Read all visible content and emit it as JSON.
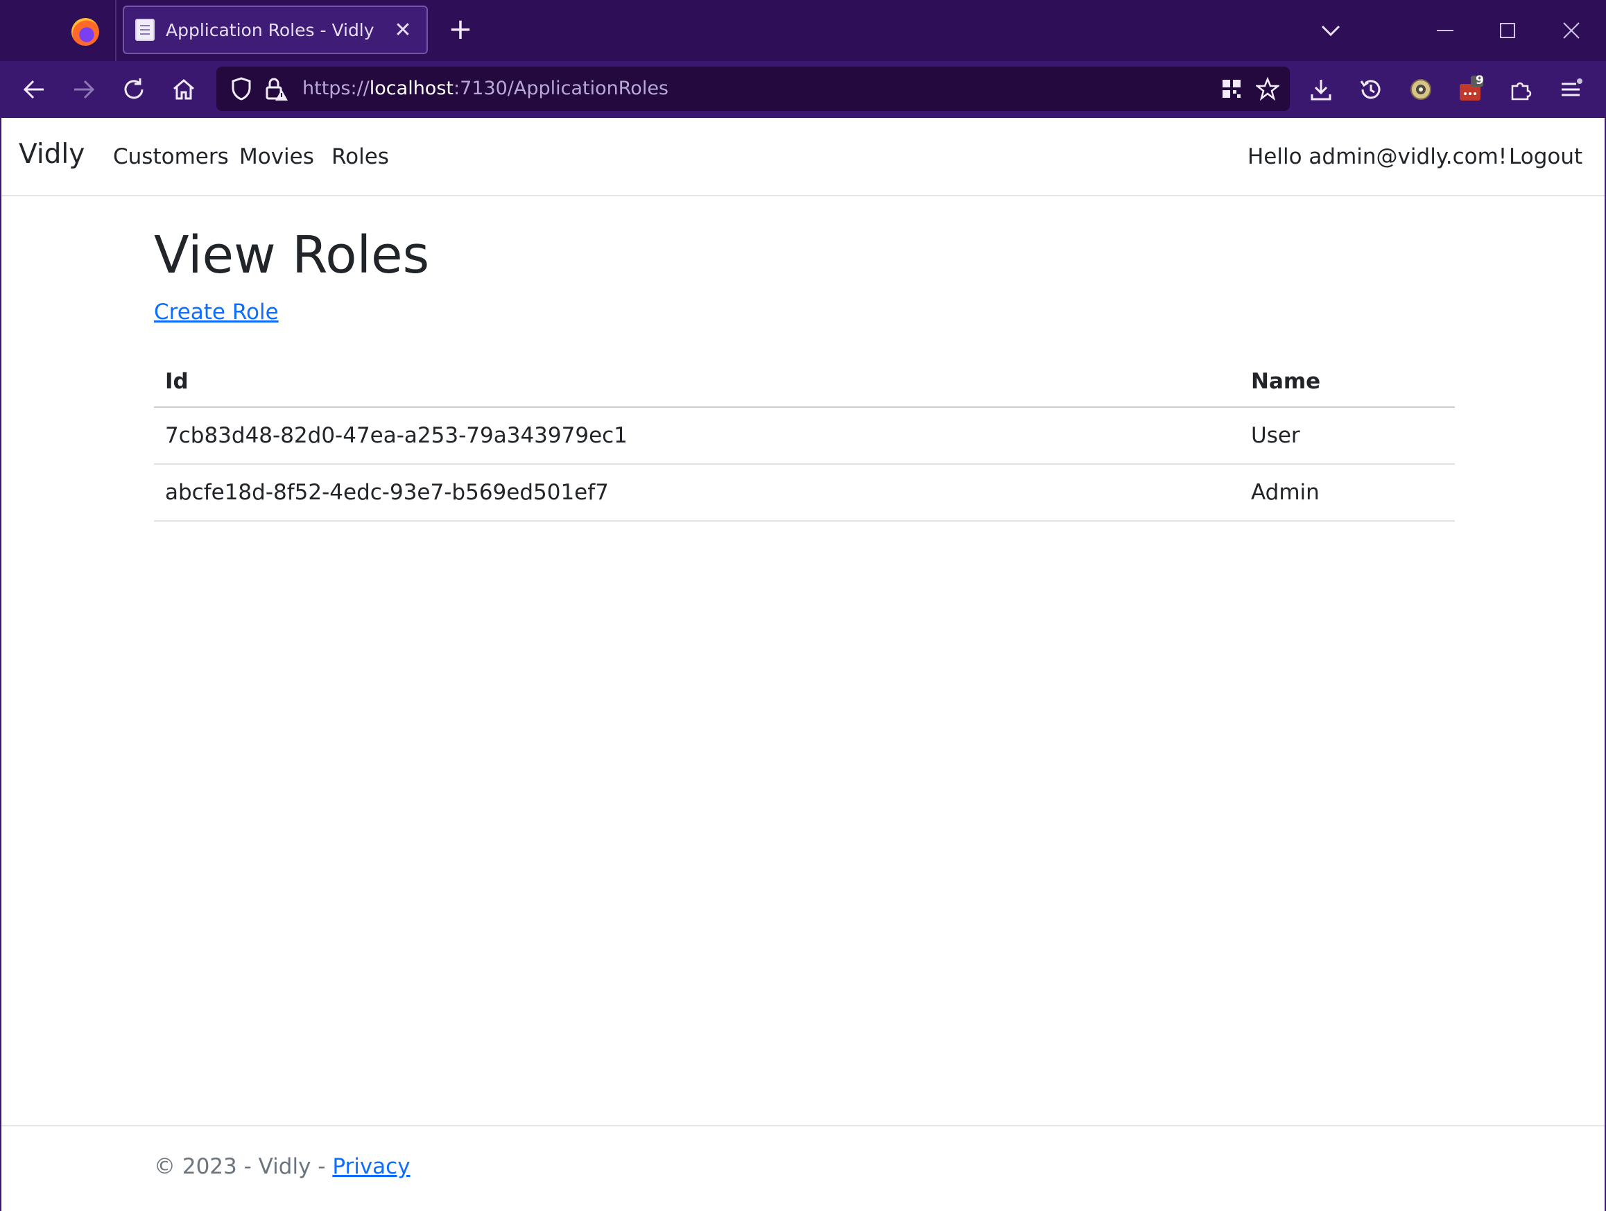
{
  "browser": {
    "tab_title": "Application Roles - Vidly",
    "tab_close": "✕",
    "new_tab": "+",
    "url_scheme": "https://",
    "url_host": "localhost",
    "url_rest": ":7130/ApplicationRoles",
    "extension_badge": "9"
  },
  "site": {
    "brand": "Vidly",
    "nav": {
      "customers": "Customers",
      "movies": "Movies",
      "roles": "Roles"
    },
    "greeting": "Hello admin@vidly.com!",
    "logout": "Logout"
  },
  "main": {
    "title": "View Roles",
    "create_link": "Create Role",
    "table": {
      "headers": {
        "id": "Id",
        "name": "Name"
      },
      "rows": [
        {
          "id": "7cb83d48-82d0-47ea-a253-79a343979ec1",
          "name": "User"
        },
        {
          "id": "abcfe18d-8f52-4edc-93e7-b569ed501ef7",
          "name": "Admin"
        }
      ]
    }
  },
  "footer": {
    "copyright": "© 2023 - Vidly - ",
    "privacy": "Privacy"
  }
}
